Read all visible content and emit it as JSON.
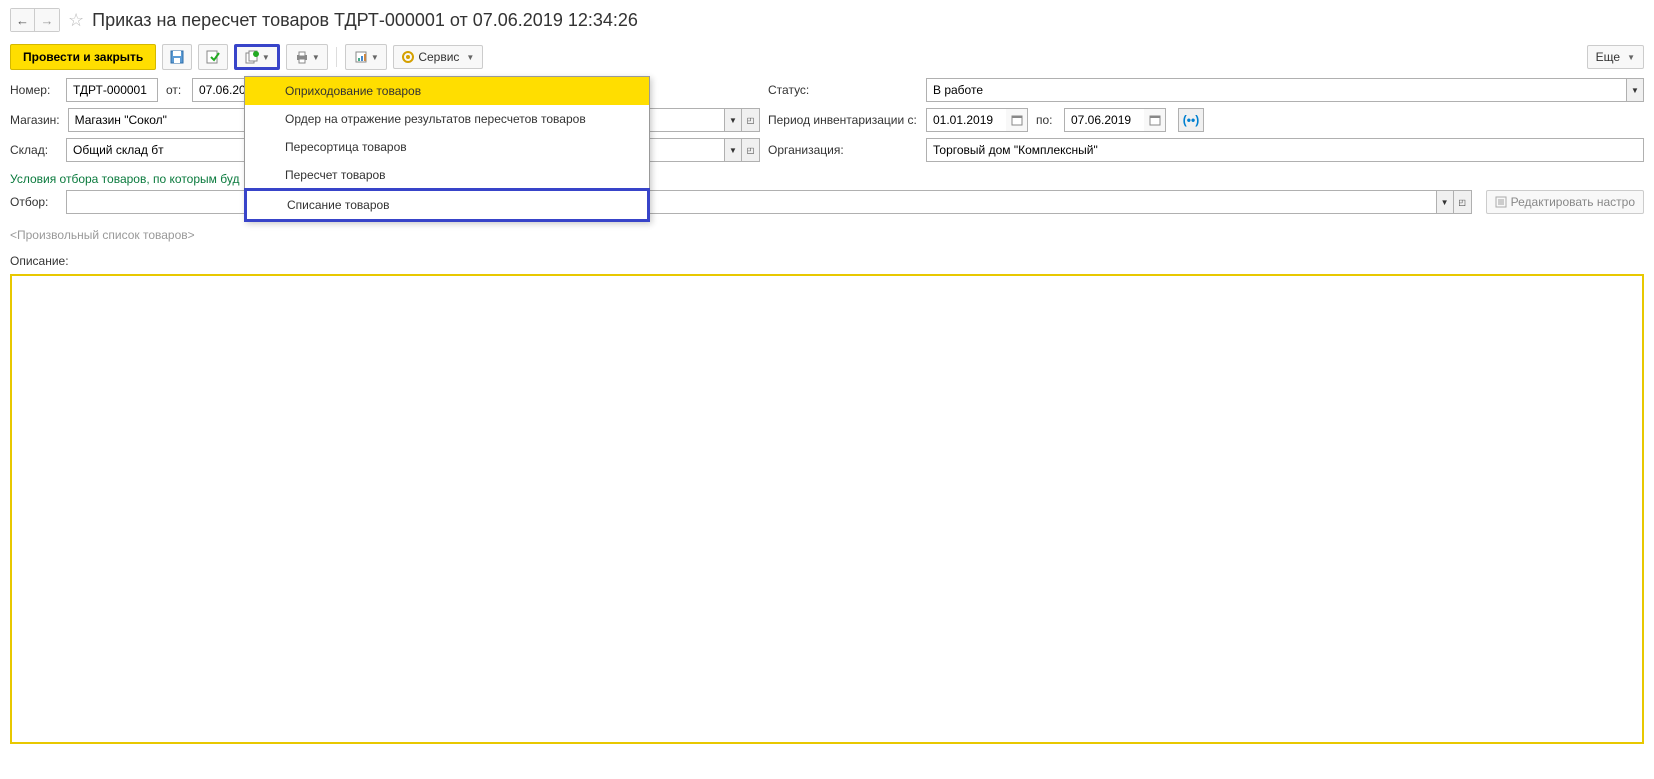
{
  "header": {
    "title": "Приказ на пересчет товаров ТДРТ-000001 от 07.06.2019 12:34:26"
  },
  "toolbar": {
    "post_and_close": "Провести и закрыть",
    "service": "Сервис",
    "more": "Еще"
  },
  "menu": {
    "item1": "Оприходование товаров",
    "item2": "Ордер на отражение результатов пересчетов товаров",
    "item3": "Пересортица товаров",
    "item4": "Пересчет товаров",
    "item5": "Списание товаров"
  },
  "form": {
    "number_label": "Номер:",
    "number_value": "ТДРТ-000001",
    "from_label": "от:",
    "date_value": "07.06.2019",
    "store_label": "Магазин:",
    "store_value": "Магазин \"Сокол\"",
    "warehouse_label": "Склад:",
    "warehouse_value": "Общий склад бт",
    "status_label": "Статус:",
    "status_value": "В работе",
    "period_label": "Период инвентаризации с:",
    "period_from": "01.01.2019",
    "period_to_label": "по:",
    "period_to": "07.06.2019",
    "org_label": "Организация:",
    "org_value": "Торговый дом \"Комплексный\"",
    "conditions_text": "Условия отбора товаров, по которым буд",
    "filter_label": "Отбор:",
    "filter_value": "",
    "edit_settings": "Редактировать настро",
    "placeholder": "<Произвольный список товаров>",
    "description_label": "Описание:"
  }
}
